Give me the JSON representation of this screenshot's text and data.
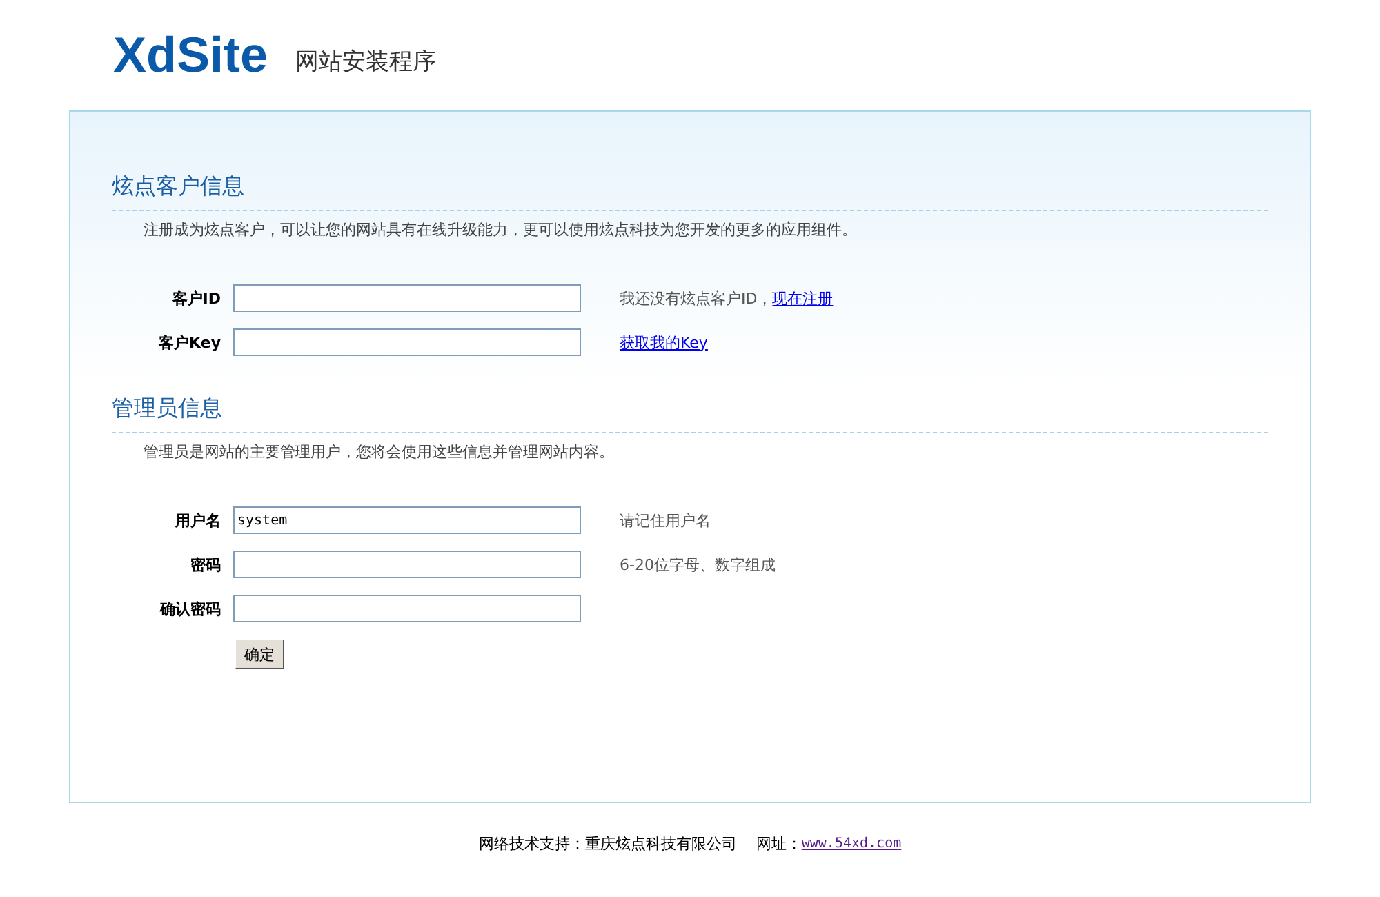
{
  "header": {
    "logo": "XdSite",
    "subtitle": "网站安装程序"
  },
  "sections": [
    {
      "title": "炫点客户信息",
      "description": "注册成为炫点客户，可以让您的网站具有在线升级能力，更可以使用炫点科技为您开发的更多的应用组件。",
      "fields": [
        {
          "label": "客户ID",
          "hint": {
            "text": "我还没有炫点客户ID，",
            "link": "现在注册"
          }
        },
        {
          "label": "客户Key",
          "hint": {
            "link": "获取我的Key"
          }
        }
      ]
    },
    {
      "title": "管理员信息",
      "description": "管理员是网站的主要管理用户，您将会使用这些信息并管理网站内容。",
      "fields": [
        {
          "label": "用户名",
          "value": "system",
          "hint": {
            "text": "请记住用户名"
          }
        },
        {
          "label": "密码",
          "hint": {
            "text": "6-20位字母、数字组成"
          }
        },
        {
          "label": "确认密码"
        }
      ]
    }
  ],
  "submit": "确定",
  "footer": {
    "text": "网络技术支持：重庆炫点科技有限公司",
    "site_label": "网址：",
    "site_link": "www.54xd.com"
  }
}
